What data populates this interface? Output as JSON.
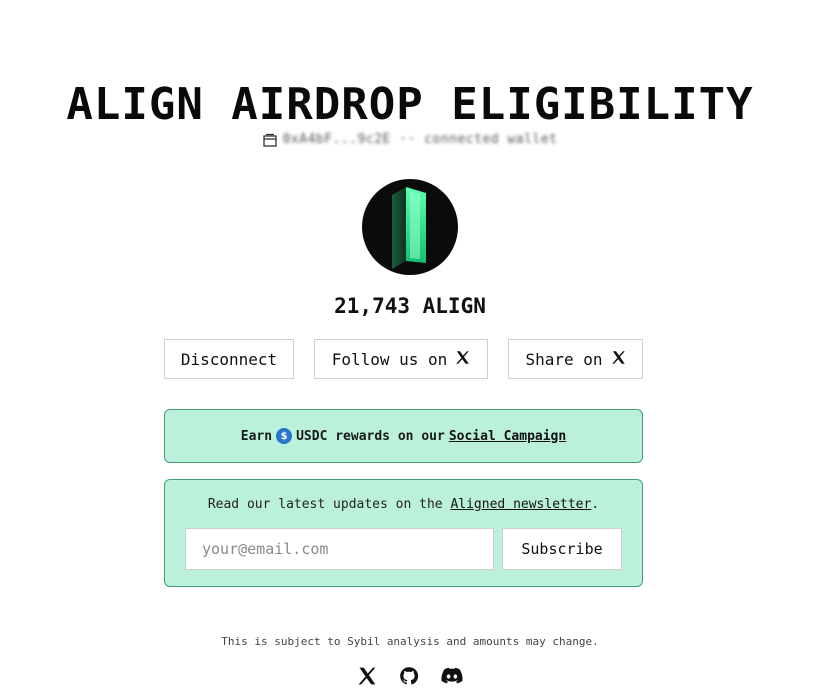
{
  "header": {
    "title": "ALIGN AIRDROP ELIGIBILITY"
  },
  "wallet": {
    "icon": "wallet-icon",
    "address": "0xA4bF...9c2E ·· connected wallet"
  },
  "reward": {
    "amount": "21,743 ALIGN"
  },
  "actions": {
    "disconnect_label": "Disconnect",
    "follow_label": "Follow us on",
    "share_label": "Share on"
  },
  "earn_banner": {
    "prefix": "Earn",
    "middle": "USDC rewards on our",
    "link": "Social Campaign",
    "accent": "#bbf1da",
    "border": "#3f9f7d"
  },
  "newsletter": {
    "text_prefix": "Read our latest updates on the",
    "link": "Aligned newsletter",
    "text_suffix": ".",
    "email_placeholder": "your@email.com",
    "subscribe_label": "Subscribe"
  },
  "footer": {
    "disclaimer": "This is subject to Sybil analysis and amounts may change.",
    "icons": [
      "x-icon",
      "github-icon",
      "discord-icon"
    ]
  }
}
